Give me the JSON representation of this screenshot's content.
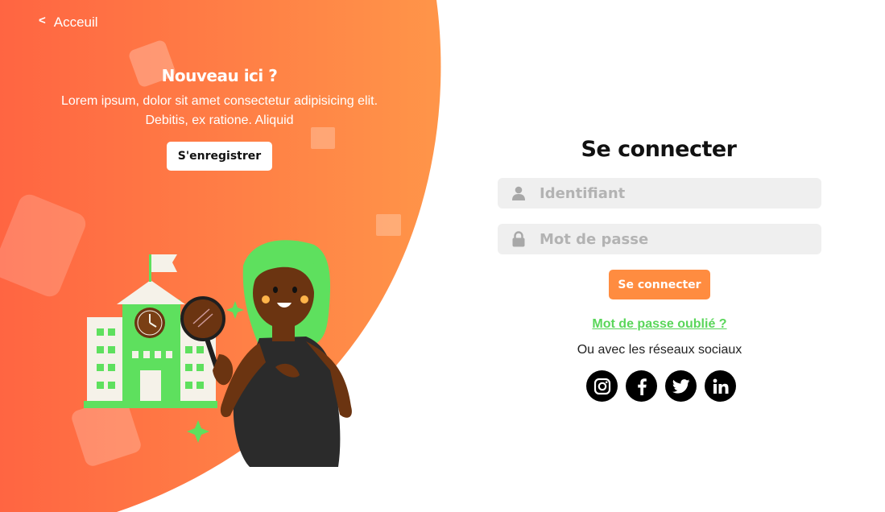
{
  "nav": {
    "back_label": "Acceuil"
  },
  "promo": {
    "title": "Nouveau ici ?",
    "text": "Lorem ipsum, dolor sit amet consectetur adipisicing elit. Debitis, ex ratione. Aliquid",
    "register_label": "S'enregistrer"
  },
  "login": {
    "title": "Se connecter",
    "username": {
      "placeholder": "Identifiant",
      "value": "",
      "icon": "user-icon"
    },
    "password": {
      "placeholder": "Mot de passe",
      "value": "",
      "icon": "lock-icon"
    },
    "submit_label": "Se connecter",
    "forgot_label": "Mot de passe oublié ?",
    "social_text": "Ou avec les réseaux sociaux",
    "socials": [
      "instagram-icon",
      "facebook-icon",
      "twitter-icon",
      "linkedin-icon"
    ]
  },
  "colors": {
    "blob_start": "#ff6a45",
    "blob_end": "#ff9348",
    "accent_button": "#ff8c40",
    "link_green": "#5ad65a",
    "input_bg": "#efefef"
  }
}
